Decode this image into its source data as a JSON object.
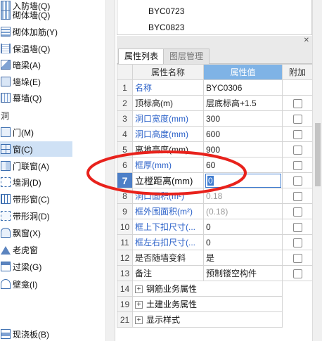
{
  "left_tree": {
    "items": [
      {
        "label": "砌体墙(Q)",
        "icon": "brick-wall-icon"
      },
      {
        "label": "砌体加筋(Y)",
        "icon": "wall-rebar-icon"
      },
      {
        "label": "保温墙(Q)",
        "icon": "insulation-wall-icon"
      },
      {
        "label": "暗梁(A)",
        "icon": "hidden-beam-icon"
      },
      {
        "label": "墙垛(E)",
        "icon": "wall-pier-icon"
      },
      {
        "label": "幕墙(Q)",
        "icon": "curtain-wall-icon"
      }
    ],
    "category": "洞",
    "openings": [
      {
        "label": "门(M)",
        "icon": "door-icon"
      },
      {
        "label": "窗(C)",
        "icon": "window-icon",
        "selected": true
      },
      {
        "label": "门联窗(A)",
        "icon": "door-window-icon"
      },
      {
        "label": "墙洞(D)",
        "icon": "wall-hole-icon"
      },
      {
        "label": "带形窗(C)",
        "icon": "strip-window-icon"
      },
      {
        "label": "带形洞(D)",
        "icon": "strip-hole-icon"
      },
      {
        "label": "飘窗(X)",
        "icon": "bay-window-icon"
      },
      {
        "label": "老虎窗",
        "icon": "dormer-window-icon"
      },
      {
        "label": "过梁(G)",
        "icon": "lintel-icon"
      },
      {
        "label": "壁龛(I)",
        "icon": "niche-icon"
      }
    ],
    "bottom_item": {
      "label": "现浇板(B)",
      "icon": "cast-slab-icon"
    }
  },
  "top_list": [
    "BYC0723",
    "BYC0823"
  ],
  "tabs": {
    "active": "属性列表",
    "inactive": "图层管理"
  },
  "grid": {
    "headers": {
      "name": "属性名称",
      "value": "属性值",
      "attach": "附加"
    },
    "rows": [
      {
        "no": "1",
        "name": "名称",
        "value": "BYC0306",
        "style": "blue",
        "check": false
      },
      {
        "no": "2",
        "name": "顶标高(m)",
        "value": "层底标高+1.5",
        "style": "normal",
        "check": true
      },
      {
        "no": "3",
        "name": "洞口宽度(mm)",
        "value": "300",
        "style": "blue",
        "check": true
      },
      {
        "no": "4",
        "name": "洞口高度(mm)",
        "value": "600",
        "style": "blue",
        "check": true
      },
      {
        "no": "5",
        "name": "离地高度(mm)",
        "value": "900",
        "style": "normal",
        "check": true
      },
      {
        "no": "6",
        "name": "框厚(mm)",
        "value": "60",
        "style": "blue",
        "check": true
      },
      {
        "no": "7",
        "name": "立樘距离(mm)",
        "value": "0",
        "style": "edit",
        "check": true
      },
      {
        "no": "8",
        "name": "洞口面积(m²)",
        "value": "0.18",
        "style": "blue-gray",
        "check": true
      },
      {
        "no": "9",
        "name": "框外围面积(m²)",
        "value": "(0.18)",
        "style": "blue-gray",
        "check": true
      },
      {
        "no": "10",
        "name": "框上下扣尺寸(...",
        "value": "0",
        "style": "blue",
        "check": true
      },
      {
        "no": "11",
        "name": "框左右扣尺寸(...",
        "value": "0",
        "style": "blue",
        "check": true
      },
      {
        "no": "12",
        "name": "是否随墙变斜",
        "value": "是",
        "style": "normal",
        "check": true
      },
      {
        "no": "13",
        "name": "备注",
        "value": "预制镂空构件",
        "style": "normal",
        "check": true
      },
      {
        "no": "14",
        "name": "钢筋业务属性",
        "value": "",
        "style": "group",
        "check": false
      },
      {
        "no": "19",
        "name": "土建业务属性",
        "value": "",
        "style": "group",
        "check": false
      },
      {
        "no": "21",
        "name": "显示样式",
        "value": "",
        "style": "group",
        "check": false
      }
    ]
  },
  "colors": {
    "annotation": "#e8221c",
    "header_accent": "#7fb3e6",
    "link_blue": "#2c62c9"
  }
}
